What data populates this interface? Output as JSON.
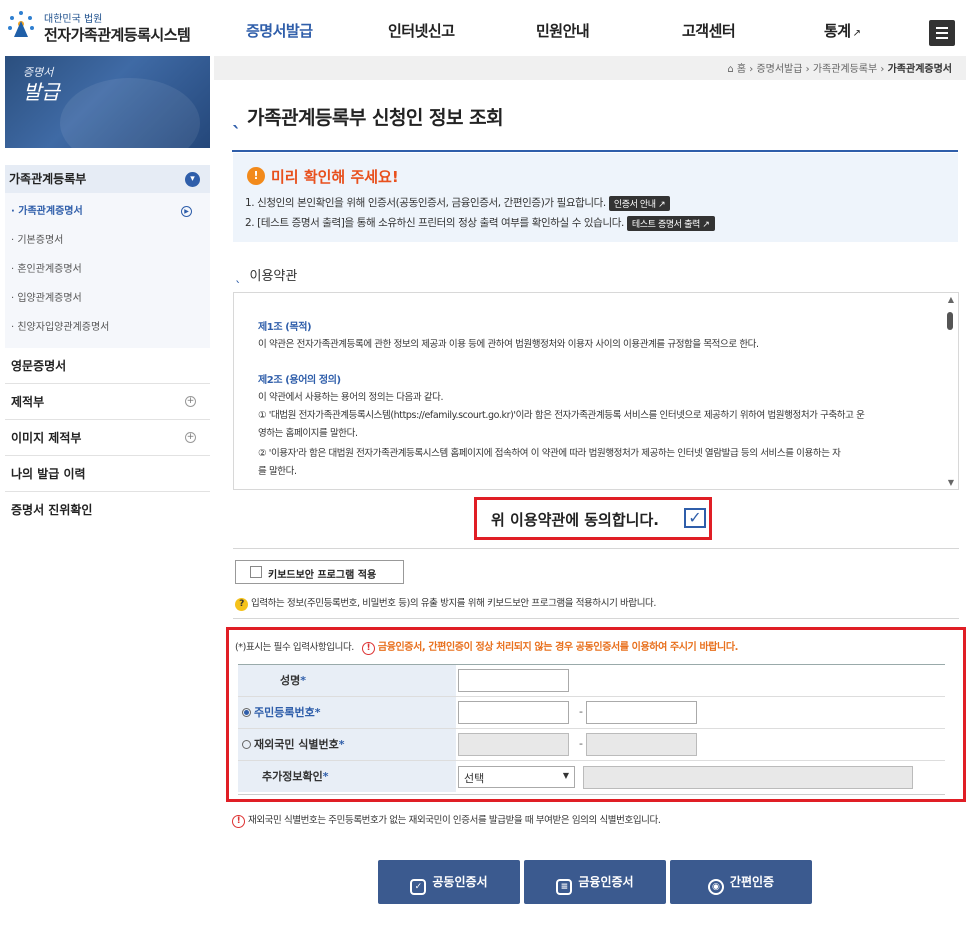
{
  "header": {
    "org": "대한민국 법원",
    "site_name": "전자가족관계등록시스템",
    "nav": [
      "증명서발급",
      "인터넷신고",
      "민원안내",
      "고객센터",
      "통계"
    ],
    "external_mark": "↗"
  },
  "breadcrumb": {
    "home": "홈",
    "items": [
      "증명서발급",
      "가족관계등록부",
      "가족관계증명서"
    ]
  },
  "banner": {
    "small": "증명서",
    "big": "발급"
  },
  "sidebar": {
    "section": "가족관계등록부",
    "subitems": [
      "· 가족관계증명서",
      "· 기본증명서",
      "· 혼인관계증명서",
      "· 입양관계증명서",
      "· 친양자입양관계증명서"
    ],
    "items": [
      "영문증명서",
      "제적부",
      "이미지 제적부",
      "나의 발급 이력",
      "증명서 진위확인"
    ]
  },
  "page_title": "가족관계등록부 신청인 정보 조회",
  "notice": {
    "heading": "미리 확인해 주세요!",
    "line1": "1. 신청인의 본인확인을 위해 인증서(공동인증서, 금융인증서, 간편인증)가 필요합니다.",
    "line1_btn": "인증서 안내",
    "line2": "2. [테스트 증명서 출력]을 통해 소유하신 프린터의 정상 출력 여부를 확인하실 수 있습니다.",
    "line2_btn": "테스트 증명서 출력"
  },
  "terms": {
    "title": "이용약관",
    "art1_head": "제1조 (목적)",
    "art1_body": "이 약관은 전자가족관계등록에 관한 정보의 제공과 이용 등에 관하여 법원행정처와 이용자 사이의 이용관계를 규정함을 목적으로 한다.",
    "art2_head": "제2조 (용어의 정의)",
    "art2_l1": "이 약관에서 사용하는 용어의 정의는 다음과 같다.",
    "art2_l2": "① '대법원 전자가족관계등록시스템(https://efamily.scourt.go.kr)'이라 함은 전자가족관계등록 서비스를 인터넷으로 제공하기 위하여 법원행정처가 구축하고 운",
    "art2_l3": "영하는 홈페이지를 말한다.",
    "art2_l4": "② '이용자'라 함은 대법원 전자가족관계등록시스템 홈페이지에 접속하여 이 약관에 따라 법원행정처가 제공하는 인터넷 열람발급 등의 서비스를 이용하는 자",
    "art2_l5": "를 말한다."
  },
  "agree": {
    "label": "위 이용약관에 동의합니다.",
    "checked": true
  },
  "keyboard": {
    "button": "키보드보안 프로그램 적용",
    "note": "입력하는 정보(주민등록번호, 비밀번호 등)의 유출 방지를 위해 키보드보안 프로그램을 적용하시기 바랍니다."
  },
  "form": {
    "required_note": "(*)표시는 필수 입력사항입니다.",
    "warning": "금융인증서, 간편인증이 정상 처리되지 않는 경우 공동인증서를 이용하여 주시기 바랍니다.",
    "name_label": "성명",
    "rrn_label": "주민등록번호",
    "foreign_label": "재외국민 식별번호",
    "extra_label": "추가정보확인",
    "star": "*",
    "dash": "-",
    "select_value": "선택",
    "rrn_selected": true
  },
  "footnote": "재외국민 식별번호는 주민등록번호가 없는 재외국민이 인증서를 발급받을 때 부여받은 임의의 식별번호입니다.",
  "buttons": [
    "공동인증서",
    "금융인증서",
    "간편인증"
  ],
  "colors": {
    "primary": "#2f5eaa",
    "highlight_border": "#e01e25",
    "warning_text": "#e8701d",
    "button_bg": "#3b5a8f"
  }
}
